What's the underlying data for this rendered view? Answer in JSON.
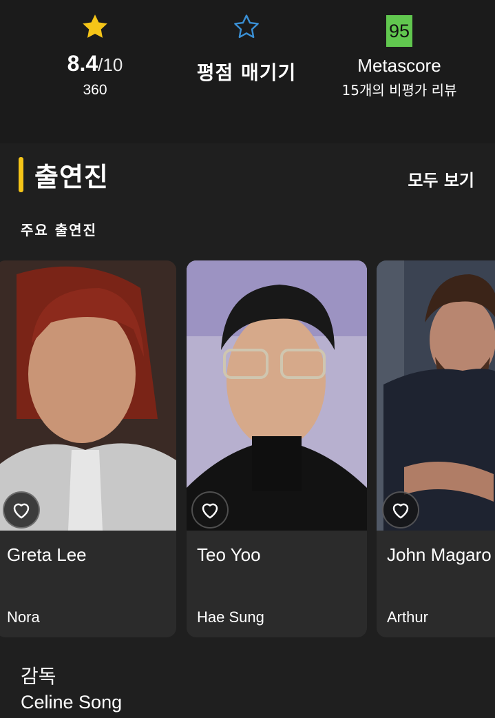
{
  "ratings": {
    "imdb": {
      "score": "8.4",
      "denominator": "/10",
      "votes": "360"
    },
    "user": {
      "label": "평점 매기기"
    },
    "metascore": {
      "value": "95",
      "label": "Metascore",
      "reviews": "15개의 비평가 리뷰"
    }
  },
  "cast": {
    "title": "출연진",
    "see_all": "모두 보기",
    "subtitle": "주요 출연진",
    "members": [
      {
        "name": "Greta Lee",
        "character": "Nora"
      },
      {
        "name": "Teo Yoo",
        "character": "Hae Sung"
      },
      {
        "name": "John Magaro",
        "character": "Arthur"
      }
    ]
  },
  "director": {
    "label": "감독",
    "name": "Celine Song"
  },
  "colors": {
    "accent": "#f5c518",
    "metascore_green": "#61c74f",
    "rate_star": "#3a8fd4",
    "background": "#1f1f1f",
    "card": "#2b2b2b"
  },
  "icons": [
    "star-filled-icon",
    "star-outline-icon",
    "heart-outline-icon"
  ]
}
